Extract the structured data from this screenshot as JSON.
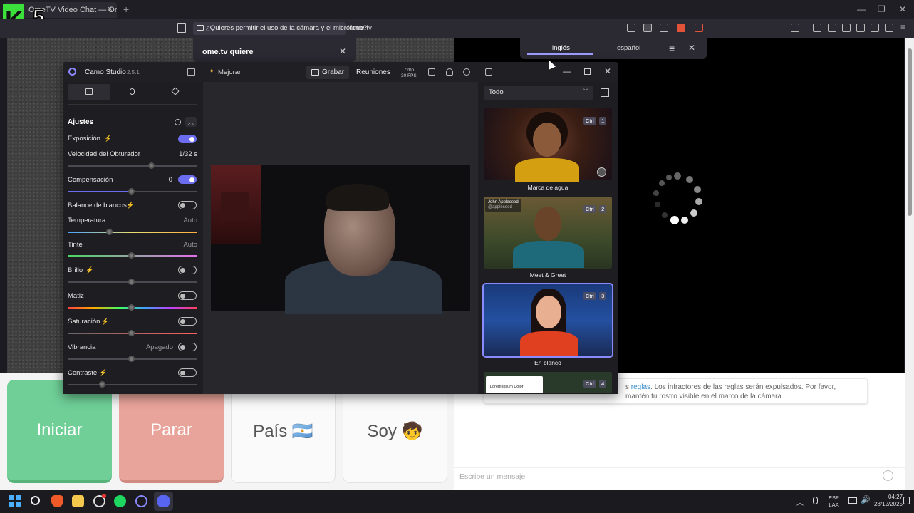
{
  "browser": {
    "tab_title": "OmeTV Video Chat — Omegle A",
    "permission_prompt": "¿Quieres permitir el uso de la cámara y el micrófono?",
    "url": "ome.tv",
    "permission_popup_title": "ome.tv quiere",
    "translate": {
      "lang_active": "inglés",
      "lang_other": "español"
    }
  },
  "overlay_logo": {
    "letter": "K",
    "number": "5"
  },
  "camo": {
    "app_name": "Camo Studio",
    "version": "2.5.1",
    "enhance_label": "Mejorar",
    "record_label": "Grabar",
    "meetings_label": "Reuniones",
    "resolution": "720p",
    "fps": "30 FPS",
    "settings_title": "Ajustes",
    "settings": [
      {
        "label": "Exposición",
        "value": ""
      },
      {
        "label": "Velocidad del Obturador",
        "value": "1/32 s"
      },
      {
        "label": "Compensación",
        "value": "0"
      },
      {
        "label": "Balance de blancos",
        "value": ""
      },
      {
        "label": "Temperatura",
        "value": "Auto"
      },
      {
        "label": "Tinte",
        "value": "Auto"
      },
      {
        "label": "Brillo",
        "value": ""
      },
      {
        "label": "Matiz",
        "value": ""
      },
      {
        "label": "Saturación",
        "value": ""
      },
      {
        "label": "Vibrancia",
        "value": "Apagado"
      },
      {
        "label": "Contraste",
        "value": ""
      }
    ],
    "scene_filter": "Todo",
    "scenes": [
      {
        "label": "Marca de agua",
        "shortcut": "Ctrl",
        "number": "1"
      },
      {
        "label": "Meet & Greet",
        "shortcut": "Ctrl",
        "number": "2",
        "chip_name": "John Appleseed",
        "chip_handle": "@appleseed"
      },
      {
        "label": "En blanco",
        "shortcut": "Ctrl",
        "number": "3"
      },
      {
        "label": "",
        "shortcut": "Ctrl",
        "number": "4",
        "card_text": "Lorem ipsum Dolor"
      }
    ]
  },
  "ometv": {
    "start_label": "Iniciar",
    "stop_label": "Parar",
    "country_label": "País 🇦🇷",
    "gender_label": "Soy 🧒",
    "rules_link": "reglas",
    "rules_text_1": "s ",
    "rules_text_2": ". Los infractores de las reglas serán expulsados. Por favor, mantén tu rostro visible en el marco de la cámara.",
    "message_placeholder": "Escribe un mensaje"
  },
  "taskbar": {
    "lang": "ESP",
    "lang_sub": "LAA",
    "time": "04:27",
    "date": "28/12/2025"
  },
  "colors": {
    "accent": "#6c6cf0",
    "start_green": "#6fcf97",
    "stop_red": "#e8a39a"
  }
}
